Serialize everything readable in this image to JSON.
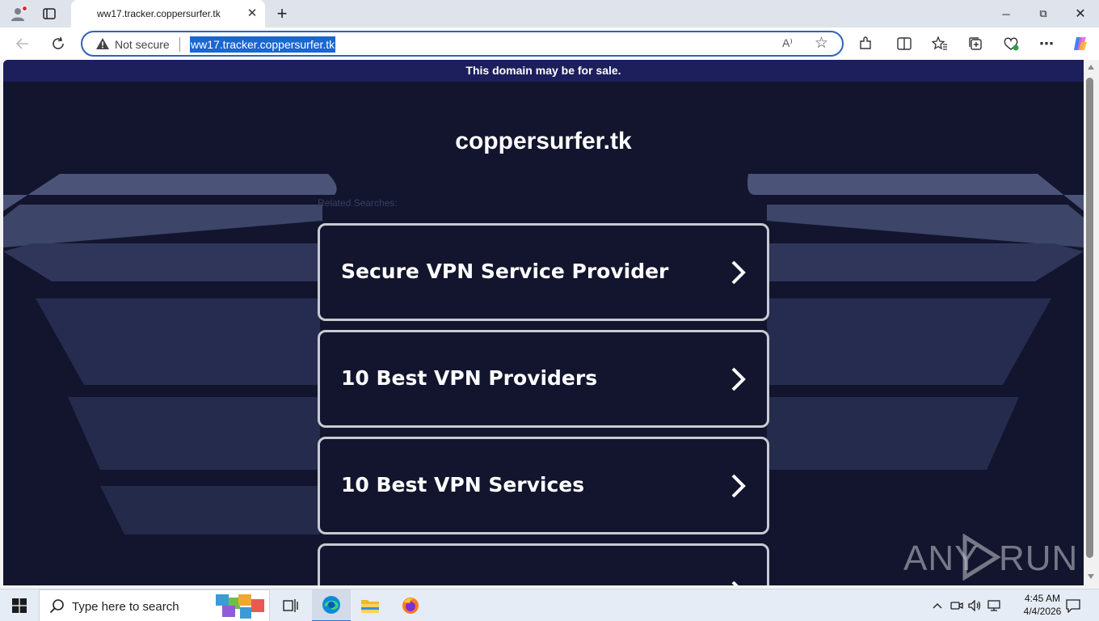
{
  "browser": {
    "tab_title": "ww17.tracker.coppersurfer.tk",
    "tab_close_icon": "close-icon",
    "new_tab_icon": "plus-icon",
    "window_controls": {
      "minimize": "─",
      "maximize": "⧉",
      "close": "✕"
    },
    "security_label": "Not secure",
    "url": "ww17.tracker.coppersurfer.tk",
    "read_aloud_label": "A⁾",
    "accent_color": "#2e63b5"
  },
  "page": {
    "banner_text": "This domain may be for sale.",
    "domain_title": "coppersurfer.tk",
    "related_label": "Related Searches:",
    "search_links": [
      {
        "label": "Secure VPN Service Provider"
      },
      {
        "label": "10 Best VPN Providers"
      },
      {
        "label": "10 Best VPN Services"
      },
      {
        "label": ""
      }
    ],
    "background_color": "#12152d",
    "banner_color": "#1c1f5c"
  },
  "watermark": {
    "left": "ANY",
    "right": "RUN"
  },
  "taskbar": {
    "search_placeholder": "Type here to search",
    "time": "4:45 AM",
    "date": "4/4/2026"
  }
}
